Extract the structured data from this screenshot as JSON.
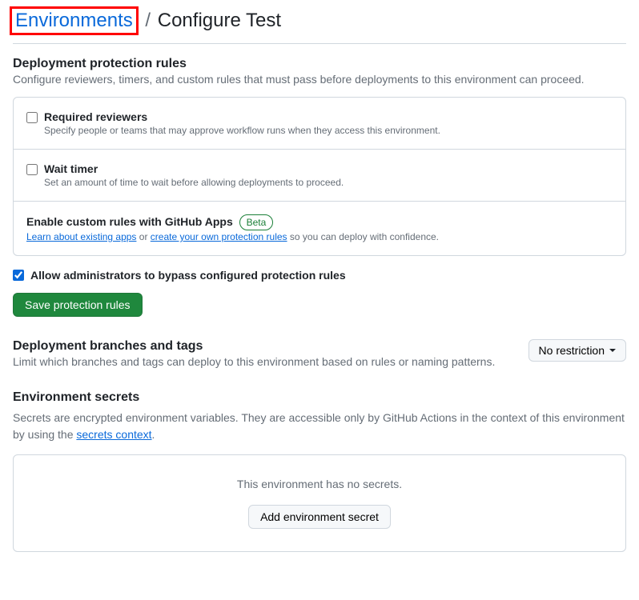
{
  "breadcrumb": {
    "link_label": "Environments",
    "separator": "/",
    "current": "Configure Test"
  },
  "protection": {
    "title": "Deployment protection rules",
    "desc": "Configure reviewers, timers, and custom rules that must pass before deployments to this environment can proceed.",
    "rules": [
      {
        "label": "Required reviewers",
        "sub": "Specify people or teams that may approve workflow runs when they access this environment."
      },
      {
        "label": "Wait timer",
        "sub": "Set an amount of time to wait before allowing deployments to proceed."
      }
    ],
    "custom": {
      "title": "Enable custom rules with GitHub Apps",
      "badge": "Beta",
      "learn_link": "Learn about existing apps",
      "or_text": " or ",
      "create_link": "create your own protection rules",
      "suffix": " so you can deploy with confidence."
    },
    "admin_bypass": "Allow administrators to bypass configured protection rules",
    "save_button": "Save protection rules"
  },
  "branches": {
    "title": "Deployment branches and tags",
    "desc": "Limit which branches and tags can deploy to this environment based on rules or naming patterns.",
    "dropdown": "No restriction"
  },
  "secrets": {
    "title": "Environment secrets",
    "desc_prefix": "Secrets are encrypted environment variables. They are accessible only by GitHub Actions in the context of this environment by using the ",
    "desc_link": "secrets context",
    "desc_suffix": ".",
    "empty": "This environment has no secrets.",
    "add_button": "Add environment secret"
  }
}
